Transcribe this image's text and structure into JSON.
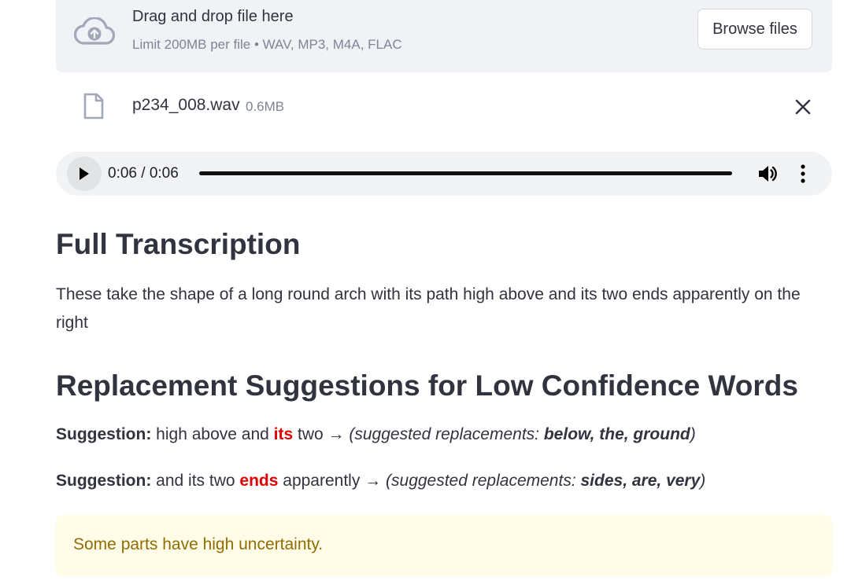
{
  "uploader": {
    "title": "Drag and drop file here",
    "limit": "Limit 200MB per file • WAV, MP3, M4A, FLAC",
    "browse_label": "Browse files",
    "icon": "cloud-upload-icon"
  },
  "file": {
    "name": "p234_008.wav",
    "size": "0.6MB",
    "icon": "file-icon",
    "remove_icon": "close-icon"
  },
  "player": {
    "time": "0:06 / 0:06",
    "progress": 1.0,
    "play_icon": "play-icon",
    "volume_icon": "volume-icon",
    "more_icon": "more-vertical-icon"
  },
  "sections": {
    "full_title": "Full Transcription",
    "transcript": "These take the shape of a long round arch with its path high above and its two ends apparently on the right",
    "replacement_title": "Replacement Suggestions for Low Confidence Words"
  },
  "suggestions": [
    {
      "label": "Suggestion:",
      "before": "high above and",
      "word": "its",
      "after": "two →",
      "prefix": "(suggested replacements:",
      "replacements": "below, the, ground",
      "suffix": ")"
    },
    {
      "label": "Suggestion:",
      "before": "and its two",
      "word": "ends",
      "after": "apparently →",
      "prefix": "(suggested replacements:",
      "replacements": "sides, are, very",
      "suffix": ")"
    }
  ],
  "warning": {
    "text": "Some parts have high uncertainty."
  },
  "colors": {
    "uploader_bg": "#f0f2f6",
    "highlight": "#e00000",
    "warning_bg": "#fffce7",
    "warning_text": "#926c05"
  }
}
